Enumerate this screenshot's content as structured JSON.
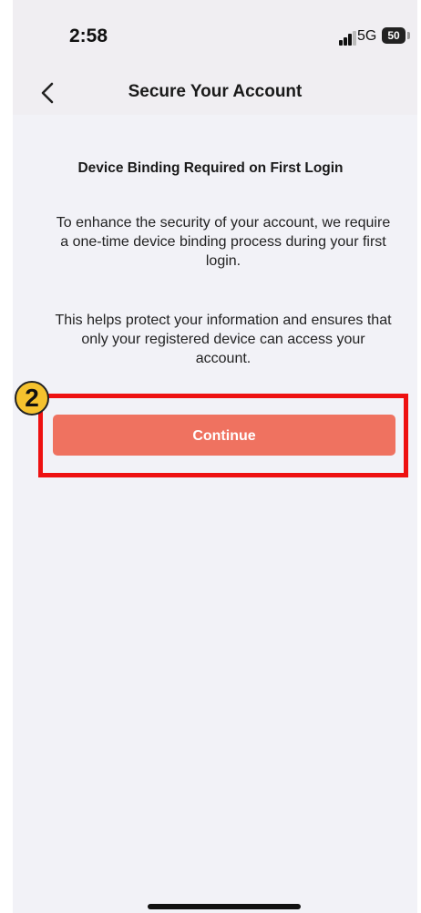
{
  "status_bar": {
    "time": "2:58",
    "network": "5G",
    "battery": "50"
  },
  "nav": {
    "title": "Secure Your Account",
    "back_icon": "chevron-left-icon"
  },
  "content": {
    "heading": "Device Binding Required on First Login",
    "paragraph_1": "To enhance the security of your account, we require a one-time device binding process during your first login.",
    "paragraph_2": "This helps protect your information and ensures that only your registered device can access your account.",
    "continue_label": "Continue"
  },
  "annotation": {
    "step_number": "2"
  },
  "colors": {
    "button": "#ef7260",
    "highlight": "#ee1111",
    "badge": "#f5c22e",
    "background": "#f2f2f7"
  }
}
